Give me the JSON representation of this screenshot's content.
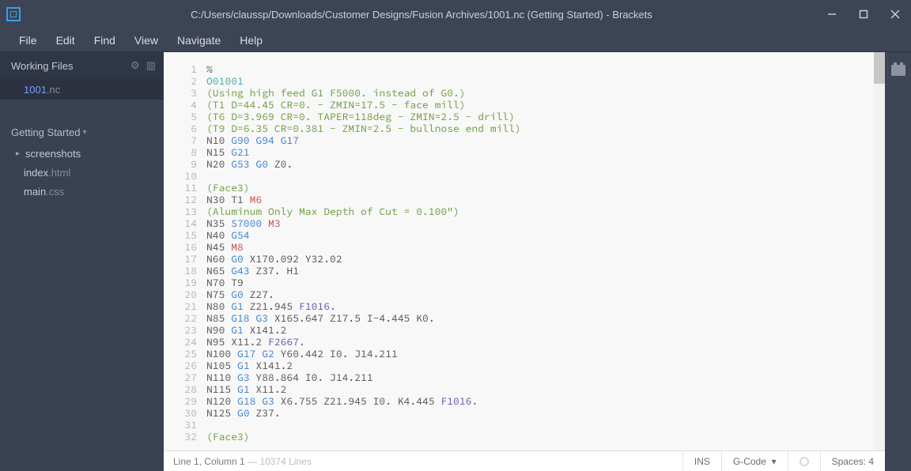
{
  "window": {
    "title": "C:/Users/claussp/Downloads/Customer Designs/Fusion Archives/1001.nc (Getting Started) - Brackets"
  },
  "menubar": [
    "File",
    "Edit",
    "Find",
    "View",
    "Navigate",
    "Help"
  ],
  "sidebar": {
    "working_files_label": "Working Files",
    "working_files": [
      {
        "name": "1001",
        "ext": ".nc",
        "active": true
      }
    ],
    "project_label": "Getting Started",
    "tree": [
      {
        "type": "folder",
        "name": "screenshots"
      },
      {
        "type": "file",
        "name": "index",
        "ext": ".html"
      },
      {
        "type": "file",
        "name": "main",
        "ext": ".css"
      }
    ]
  },
  "editor": {
    "lines": [
      [
        {
          "t": "%",
          "c": ""
        }
      ],
      [
        {
          "t": "O01001",
          "c": "program"
        }
      ],
      [
        {
          "t": "(Using high feed G1 F5000. instead of G0.)",
          "c": "comment"
        }
      ],
      [
        {
          "t": "(T1 D=44.45 CR=0. - ZMIN=17.5 - face mill)",
          "c": "comment"
        }
      ],
      [
        {
          "t": "(T6 D=3.969 CR=0. TAPER=118deg - ZMIN=2.5 - drill)",
          "c": "comment"
        }
      ],
      [
        {
          "t": "(T9 D=6.35 CR=0.381 - ZMIN=2.5 - bullnose end mill)",
          "c": "comment"
        }
      ],
      [
        {
          "t": "N10 ",
          "c": ""
        },
        {
          "t": "G90 G94 G17",
          "c": "keyword"
        }
      ],
      [
        {
          "t": "N15 ",
          "c": ""
        },
        {
          "t": "G21",
          "c": "keyword"
        }
      ],
      [
        {
          "t": "N20 ",
          "c": ""
        },
        {
          "t": "G53 G0",
          "c": "keyword"
        },
        {
          "t": " Z0.",
          "c": ""
        }
      ],
      [],
      [
        {
          "t": "(Face3)",
          "c": "comment"
        }
      ],
      [
        {
          "t": "N30 T1 ",
          "c": ""
        },
        {
          "t": "M6",
          "c": "red"
        }
      ],
      [
        {
          "t": "(Aluminum Only Max Depth of Cut = 0.100\")",
          "c": "comment"
        }
      ],
      [
        {
          "t": "N35 ",
          "c": ""
        },
        {
          "t": "S7000",
          "c": "keyword"
        },
        {
          "t": " ",
          "c": ""
        },
        {
          "t": "M3",
          "c": "red"
        }
      ],
      [
        {
          "t": "N40 ",
          "c": ""
        },
        {
          "t": "G54",
          "c": "keyword"
        }
      ],
      [
        {
          "t": "N45 ",
          "c": ""
        },
        {
          "t": "M8",
          "c": "red"
        }
      ],
      [
        {
          "t": "N60 ",
          "c": ""
        },
        {
          "t": "G0",
          "c": "keyword"
        },
        {
          "t": " X170.092 Y32.02",
          "c": ""
        }
      ],
      [
        {
          "t": "N65 ",
          "c": ""
        },
        {
          "t": "G43",
          "c": "keyword"
        },
        {
          "t": " Z37. H1",
          "c": ""
        }
      ],
      [
        {
          "t": "N70 T9",
          "c": ""
        }
      ],
      [
        {
          "t": "N75 ",
          "c": ""
        },
        {
          "t": "G0",
          "c": "keyword"
        },
        {
          "t": " Z27.",
          "c": ""
        }
      ],
      [
        {
          "t": "N80 ",
          "c": ""
        },
        {
          "t": "G1",
          "c": "keyword"
        },
        {
          "t": " Z21.945 ",
          "c": ""
        },
        {
          "t": "F1016.",
          "c": "num"
        }
      ],
      [
        {
          "t": "N85 ",
          "c": ""
        },
        {
          "t": "G18 G3",
          "c": "keyword"
        },
        {
          "t": " X165.647 Z17.5 I-4.445 K0.",
          "c": ""
        }
      ],
      [
        {
          "t": "N90 ",
          "c": ""
        },
        {
          "t": "G1",
          "c": "keyword"
        },
        {
          "t": " X141.2",
          "c": ""
        }
      ],
      [
        {
          "t": "N95 X11.2 ",
          "c": ""
        },
        {
          "t": "F2667.",
          "c": "num"
        }
      ],
      [
        {
          "t": "N100 ",
          "c": ""
        },
        {
          "t": "G17 G2",
          "c": "keyword"
        },
        {
          "t": " Y60.442 I0. J14.211",
          "c": ""
        }
      ],
      [
        {
          "t": "N105 ",
          "c": ""
        },
        {
          "t": "G1",
          "c": "keyword"
        },
        {
          "t": " X141.2",
          "c": ""
        }
      ],
      [
        {
          "t": "N110 ",
          "c": ""
        },
        {
          "t": "G3",
          "c": "keyword"
        },
        {
          "t": " Y88.864 I0. J14.211",
          "c": ""
        }
      ],
      [
        {
          "t": "N115 ",
          "c": ""
        },
        {
          "t": "G1",
          "c": "keyword"
        },
        {
          "t": " X11.2",
          "c": ""
        }
      ],
      [
        {
          "t": "N120 ",
          "c": ""
        },
        {
          "t": "G18 G3",
          "c": "keyword"
        },
        {
          "t": " X6.755 Z21.945 I0. K4.445 ",
          "c": ""
        },
        {
          "t": "F1016.",
          "c": "num"
        }
      ],
      [
        {
          "t": "N125 ",
          "c": ""
        },
        {
          "t": "G0",
          "c": "keyword"
        },
        {
          "t": " Z37.",
          "c": ""
        }
      ],
      [],
      [
        {
          "t": "(Face3)",
          "c": "comment"
        }
      ]
    ]
  },
  "status": {
    "cursor": "Line 1, Column 1",
    "total": "10374 Lines",
    "ins": "INS",
    "lang": "G-Code",
    "spaces": "Spaces: 4"
  }
}
